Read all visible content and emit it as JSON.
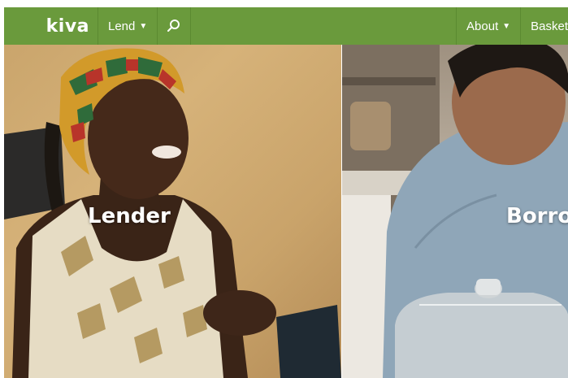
{
  "header": {
    "logo": "kiva",
    "nav": {
      "lend_label": "Lend",
      "about_label": "About",
      "basket_label": "Basket"
    },
    "icons": {
      "search": "search-icon",
      "lend_caret": "caret-down-icon",
      "about_caret": "caret-down-icon"
    },
    "colors": {
      "bar": "#6a9a3c",
      "text": "#ffffff"
    }
  },
  "hero": {
    "panels": [
      {
        "label": "Lender"
      },
      {
        "label": "Borro"
      }
    ]
  }
}
